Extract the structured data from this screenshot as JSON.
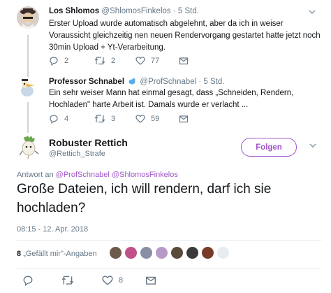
{
  "tweets": [
    {
      "name": "Los Shlomos",
      "handle": "@ShlomosFinkelos",
      "dot": "·",
      "time": "5 Std.",
      "text": "Erster Upload wurde automatisch abgelehnt, aber da ich in weiser Voraussicht gleichzeitig nen neuen Rendervorgang gestartet hatte jetzt noch 30min Upload + Yt-Verarbeitung.",
      "replies": "2",
      "retweets": "2",
      "likes": "77"
    },
    {
      "name": "Professor Schnabel",
      "handle": "@ProfSchnabel",
      "dot": "·",
      "time": "5 Std.",
      "text": "Ein sehr weiser Mann hat einmal gesagt, dass „Schneiden, Rendern, Hochladen\" harte Arbeit ist. Damals wurde er verlacht ...",
      "replies": "4",
      "retweets": "3",
      "likes": "59"
    }
  ],
  "main": {
    "name": "Robuster Rettich",
    "handle": "@Rettich_Strafe",
    "follow_label": "Folgen",
    "reply_prefix": "Antwort an",
    "mention1": "@ProfSchnabel",
    "mention2": "@ShlomosFinkelos",
    "text": "Große Dateien, ich will rendern, darf ich sie hochladen?",
    "timestamp": "08:15 - 12. Apr. 2018",
    "likes_count": "8",
    "likes_label": "„Gefällt mir\"-Angaben",
    "retweets": "",
    "likes": "8"
  },
  "colors": {
    "accent": "#a055c9",
    "muted": "#657786",
    "thread_line": "#ccd6dd",
    "divider": "#e6ecf0"
  }
}
